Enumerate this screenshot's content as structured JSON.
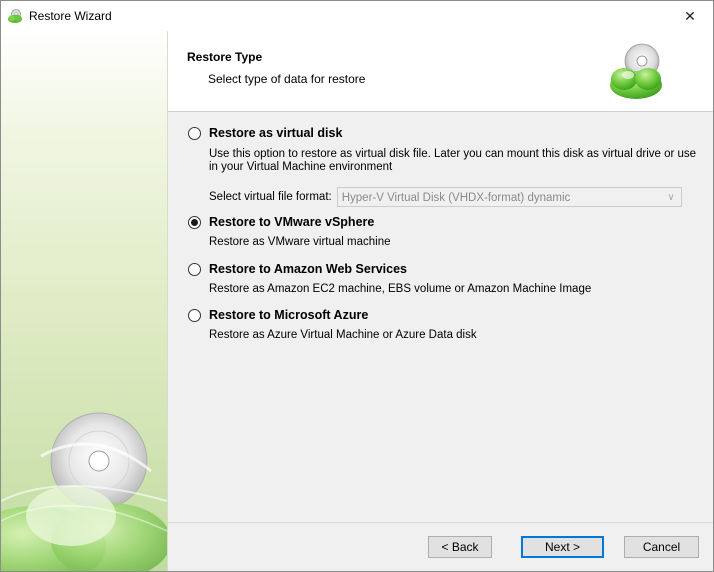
{
  "window": {
    "title": "Restore Wizard",
    "close_glyph": "✕"
  },
  "header": {
    "title": "Restore Type",
    "subtitle": "Select type of data for restore"
  },
  "options": [
    {
      "label": "Restore as virtual disk",
      "description": "Use this option to restore as virtual disk file. Later you can mount this disk as virtual drive or use in your Virtual Machine environment",
      "checked": false
    },
    {
      "label": "Restore to VMware vSphere",
      "description": "Restore as VMware virtual machine",
      "checked": true
    },
    {
      "label": "Restore to Amazon Web Services",
      "description": "Restore as Amazon EC2 machine, EBS volume or Amazon Machine Image",
      "checked": false
    },
    {
      "label": "Restore to Microsoft Azure",
      "description": "Restore as Azure Virtual Machine or Azure Data disk",
      "checked": false
    }
  ],
  "format": {
    "label": "Select virtual file format:",
    "selected": "Hyper-V Virtual Disk (VHDX-format) dynamic",
    "disabled": true
  },
  "buttons": {
    "back": "< Back",
    "next": "Next >",
    "cancel": "Cancel"
  },
  "colors": {
    "accent": "#0078d7",
    "brand_green": "#5cb833"
  },
  "icons": {
    "app": "cloud-disc-icon",
    "header": "cloud-disc-icon",
    "close": "close-icon",
    "dropdown": "chevron-down-icon"
  }
}
